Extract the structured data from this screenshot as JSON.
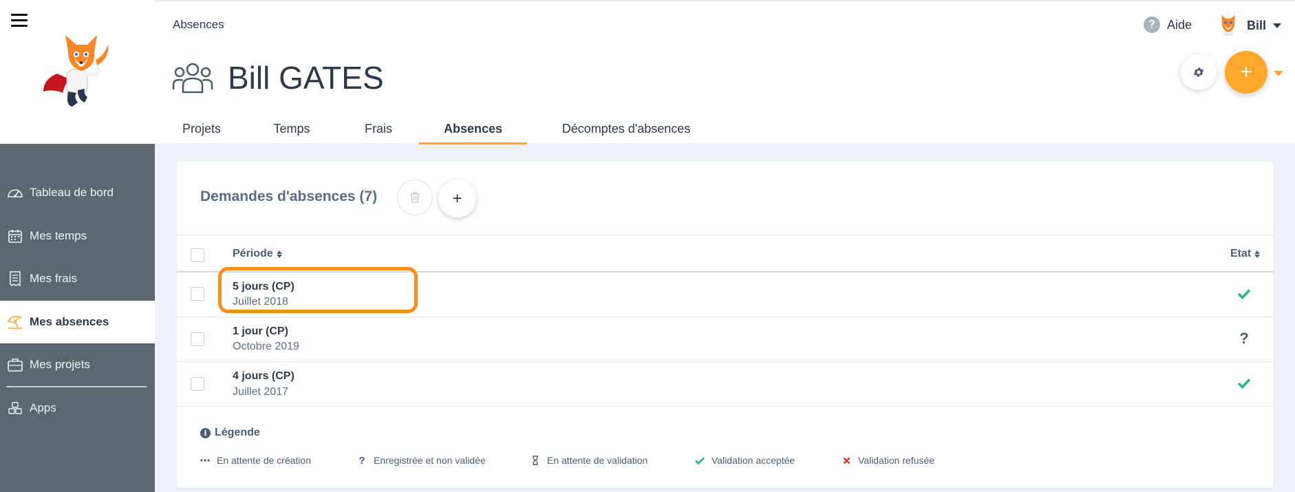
{
  "sidebar": {
    "items": [
      {
        "label": "Tableau de bord",
        "icon": "dashboard-gauge-icon"
      },
      {
        "label": "Mes temps",
        "icon": "calendar-icon"
      },
      {
        "label": "Mes frais",
        "icon": "receipt-icon"
      },
      {
        "label": "Mes absences",
        "icon": "beach-umbrella-icon",
        "active": true
      },
      {
        "label": "Mes projets",
        "icon": "briefcase-icon"
      },
      {
        "label": "Apps",
        "icon": "cubes-icon"
      }
    ]
  },
  "header": {
    "breadcrumb": "Absences",
    "title": "Bill GATES",
    "help_label": "Aide",
    "user_name": "Bill"
  },
  "tabs": [
    {
      "label": "Projets"
    },
    {
      "label": "Temps"
    },
    {
      "label": "Frais"
    },
    {
      "label": "Absences",
      "active": true
    },
    {
      "label": "Décomptes d'absences"
    }
  ],
  "card": {
    "title": "Demandes d'absences (7)",
    "columns": {
      "period": "Période",
      "state": "Etat"
    },
    "rows": [
      {
        "title": "5 jours (CP)",
        "subtitle": "Juillet 2018",
        "state": "validated"
      },
      {
        "title": "1 jour (CP)",
        "subtitle": "Octobre 2019",
        "state": "registered"
      },
      {
        "title": "4 jours (CP)",
        "subtitle": "Juillet 2017",
        "state": "validated"
      }
    ]
  },
  "legend": {
    "title": "Légende",
    "items": [
      {
        "label": "En attente de création",
        "icon": "ellipsis-icon"
      },
      {
        "label": "Enregistrée et non validée",
        "icon": "question-icon"
      },
      {
        "label": "En attente de validation",
        "icon": "hourglass-icon"
      },
      {
        "label": "Validation acceptée",
        "icon": "check-icon"
      },
      {
        "label": "Validation refusée",
        "icon": "cross-icon"
      }
    ]
  },
  "colors": {
    "accent": "#fda72c",
    "sidebar": "#5d6770",
    "success": "#27b58a",
    "danger": "#e0312b",
    "highlight": "#fb8d1a"
  }
}
